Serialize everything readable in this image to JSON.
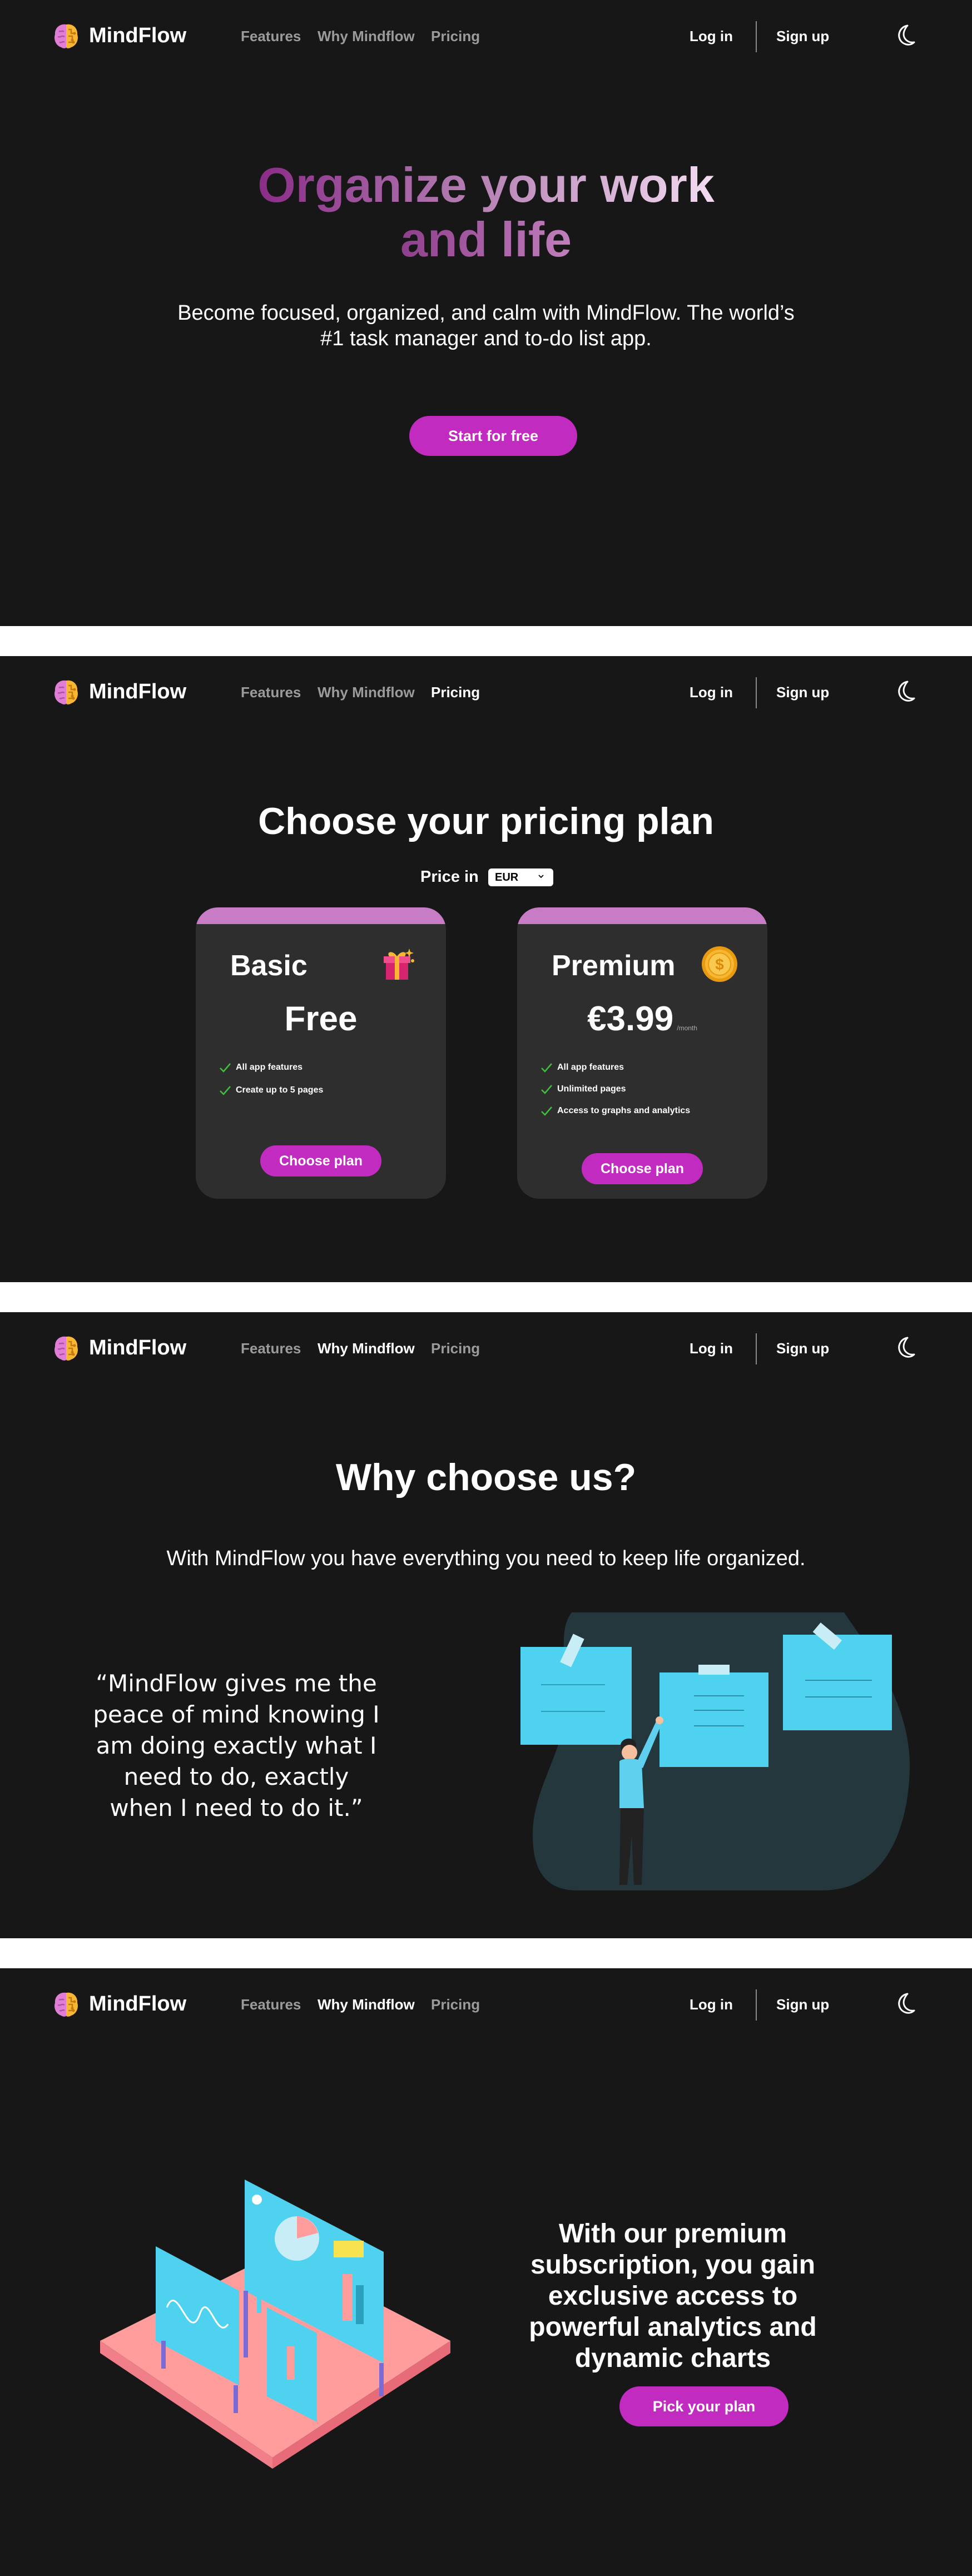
{
  "nav": {
    "brand": "MindFlow",
    "links": [
      "Features",
      "Why Mindflow",
      "Pricing"
    ],
    "login": "Log in",
    "signup": "Sign up"
  },
  "hero": {
    "title_line1": "Organize your work",
    "title_line2": "and life",
    "subtitle": "Become focused, organized, and calm with MindFlow. The world’s #1 task manager and to-do list app.",
    "cta": "Start for free"
  },
  "pricing": {
    "title": "Choose your pricing plan",
    "price_in_label": "Price in",
    "currency": "EUR",
    "plans": [
      {
        "name": "Basic",
        "price": "Free",
        "period": "",
        "icon": "gift-icon",
        "features": [
          "All app features",
          "Create up to 5 pages"
        ],
        "cta": "Choose plan"
      },
      {
        "name": "Premium",
        "price": "€3.99",
        "period": "/month",
        "icon": "coin-icon",
        "features": [
          "All app features",
          "Unlimited pages",
          "Access to graphs and analytics"
        ],
        "cta": "Choose plan"
      }
    ]
  },
  "why": {
    "title": "Why choose us?",
    "subtitle": "With MindFlow you have everything you need to keep life organized.",
    "quote": "“MindFlow gives me the peace of mind knowing I am doing exactly what I need to do, exactly when I need to do it.”"
  },
  "premium": {
    "text": "With our premium subscription, you gain exclusive access to powerful analytics and dynamic charts",
    "cta": "Pick your plan"
  },
  "colors": {
    "background": "#171717",
    "accent": "#c22bc0",
    "card": "#2e2e2e",
    "card_top": "#c77cc5",
    "check": "#3fbf3f",
    "illustration_blue": "#4fd1f0",
    "illustration_pink": "#ff9d9d"
  }
}
